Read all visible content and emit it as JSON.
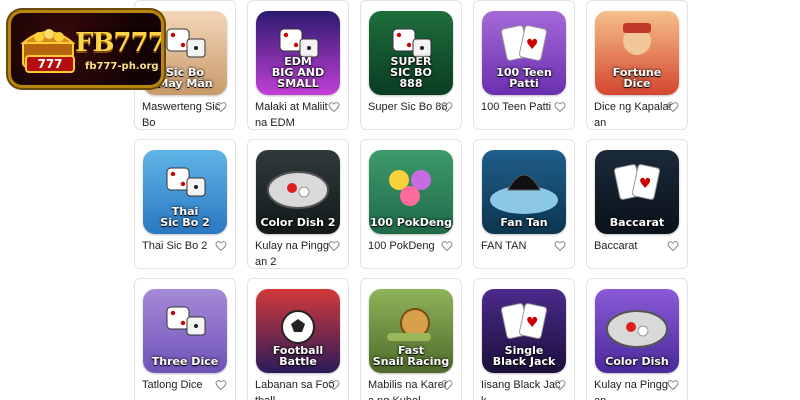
{
  "logo": {
    "brand": "FB777",
    "url": "fb777-ph.org",
    "badge": "777"
  },
  "games": [
    {
      "name": "Maswerteng Sic Bo",
      "thumb_text": "Sic Bo\nMay Mắn",
      "colors": [
        "#f3d6b8",
        "#c99a6b"
      ],
      "icon": "dice-girl-icon"
    },
    {
      "name": "Malaki at Maliit na EDM",
      "thumb_text": "EDM\nBIG AND SMALL",
      "colors": [
        "#2a1b6e",
        "#c23fd6"
      ],
      "icon": "neon-dice-icon"
    },
    {
      "name": "Super Sic Bo 88",
      "thumb_text": "SUPER\nSIC BO\n888",
      "colors": [
        "#1d6e3c",
        "#0b3d22"
      ],
      "icon": "gold-dice-icon"
    },
    {
      "name": "100 Teen Patti",
      "thumb_text": "100 Teen Patti",
      "colors": [
        "#a46ad8",
        "#6a2fb0"
      ],
      "icon": "cards-icon"
    },
    {
      "name": "Dice ng Kapalaran",
      "thumb_text": "Fortune\nDice",
      "colors": [
        "#f6c08a",
        "#d4462f"
      ],
      "icon": "fortune-god-icon"
    },
    {
      "name": "Thai Sic Bo 2",
      "thumb_text": "Thai\nSic Bo 2",
      "colors": [
        "#5fb4e6",
        "#2a78c2"
      ],
      "icon": "phone-dice-icon"
    },
    {
      "name": "Kulay na Pinggan 2",
      "thumb_text": "Color Dish 2",
      "colors": [
        "#2f3a3a",
        "#121a1a"
      ],
      "icon": "dish-icon"
    },
    {
      "name": "100 PokDeng",
      "thumb_text": "100 PokDeng",
      "colors": [
        "#3d9a6a",
        "#1f6b48"
      ],
      "icon": "slime-icon"
    },
    {
      "name": "FAN TAN",
      "thumb_text": "Fan Tan",
      "colors": [
        "#1e5f8a",
        "#0d3550"
      ],
      "icon": "bowl-icon"
    },
    {
      "name": "Baccarat",
      "thumb_text": "Baccarat",
      "colors": [
        "#1a2a3a",
        "#0a121a"
      ],
      "icon": "cards-icon"
    },
    {
      "name": "Tatlong Dice",
      "thumb_text": "Three Dice",
      "colors": [
        "#a58ad8",
        "#6f53b8"
      ],
      "icon": "three-dice-icon"
    },
    {
      "name": "Labanan sa Football",
      "thumb_text": "Football\nBattle",
      "colors": [
        "#d23a3a",
        "#2b1b5a"
      ],
      "icon": "football-icon"
    },
    {
      "name": "Mabilis na Karera ng Kuhol",
      "thumb_text": "Fast\nSnail Racing",
      "colors": [
        "#8fb35a",
        "#4e6b2a"
      ],
      "icon": "snail-icon"
    },
    {
      "name": "Iisang Black Jack",
      "thumb_text": "Single\nBlack Jack",
      "colors": [
        "#4b2a8a",
        "#1c0f3c"
      ],
      "icon": "blackjack-icon"
    },
    {
      "name": "Kulay na Pinggan",
      "thumb_text": "Color Dish",
      "colors": [
        "#8a5ad8",
        "#4a2a9a"
      ],
      "icon": "dish-icon"
    }
  ]
}
